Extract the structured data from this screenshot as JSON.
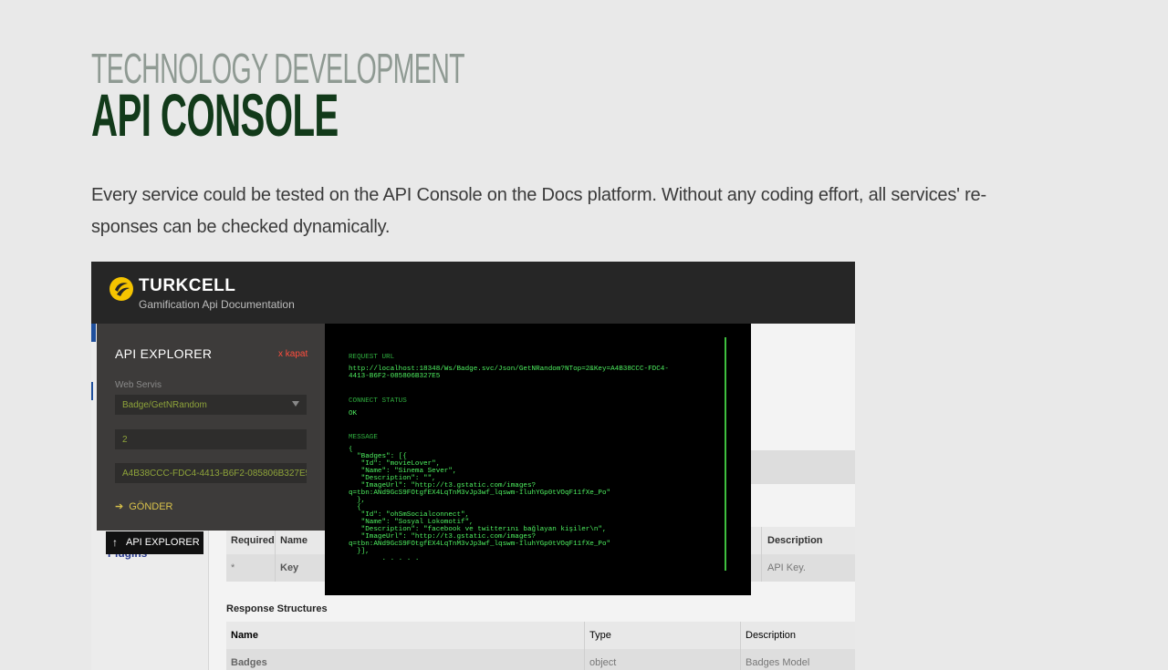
{
  "header": {
    "kicker": "TECHNOLOGY DEVELOPMENT",
    "title": "API CONSOLE"
  },
  "description": "Every service could be tested on the API Console on the Docs platform. Without any coding effort, all services' re-sponses can be checked dynamically.",
  "screenshot": {
    "brand": "TURKCELL",
    "subtitle": "Gamification Api Documentation",
    "sidebar": {
      "plugins_label": "Plugins"
    },
    "explorer": {
      "title": "API EXPLORER",
      "close_label": "x kapat",
      "service_label": "Web Servis",
      "service_value": "Badge/GetNRandom",
      "top_value": "2",
      "key_value": "A4B38CCC-FDC4-4413-B6F2-085806B327E5",
      "send_label": "GÖNDER",
      "tab_label": "API EXPLORER"
    },
    "console": {
      "request_label": "REQUEST URL",
      "request_url": "http://localhost:18348/Ws/Badge.svc/Json/GetNRandom?NTop=2&Key=A4B38CCC-FDC4-\n4413-B6F2-085806B327E5",
      "status_label": "CONNECT STATUS",
      "status_value": "OK",
      "message_label": "MESSAGE",
      "message_body": "{\n  \"Badges\": [{\n   \"Id\": \"movieLover\",\n   \"Name\": \"Sinema Sever\",\n   \"Description\": \"\",\n   \"ImageUrl\": \"http://t3.gstatic.com/images?\nq=tbn:ANd9GcS9FOtgfEX4LqTnM3vJp3wf_lqswm-IluhYGp0tVOqF11fXe_Po\"\n  },\n  {\n   \"Id\": \"ohSmSocialconnect\",\n   \"Name\": \"Sosyal Lokomotif\",\n   \"Description\": \"facebook ve twitterını bağlayan kişiler\\n\",\n   \"ImageUrl\": \"http://t3.gstatic.com/images?\nq=tbn:ANd9GcS9FOtgfEX4LqTnM3vJp3wf_lqswm-IluhYGp0tVOqF11fXe_Po\"\n  }],\n        . . . . ."
    },
    "params_table": {
      "headers": [
        "Required",
        "Name",
        "Description"
      ],
      "row": [
        "*",
        "Key",
        "API Key."
      ]
    },
    "response": {
      "title": "Response Structures",
      "headers": [
        "Name",
        "Type",
        "Description"
      ],
      "row": [
        "Badges",
        "object",
        "Badges Model"
      ]
    }
  },
  "colors": {
    "title": "#123a1a",
    "kicker": "#8f9a93",
    "console_green": "#3ecf5a",
    "close_red": "#ff4d3d",
    "send_yellow": "#d9c24a"
  }
}
